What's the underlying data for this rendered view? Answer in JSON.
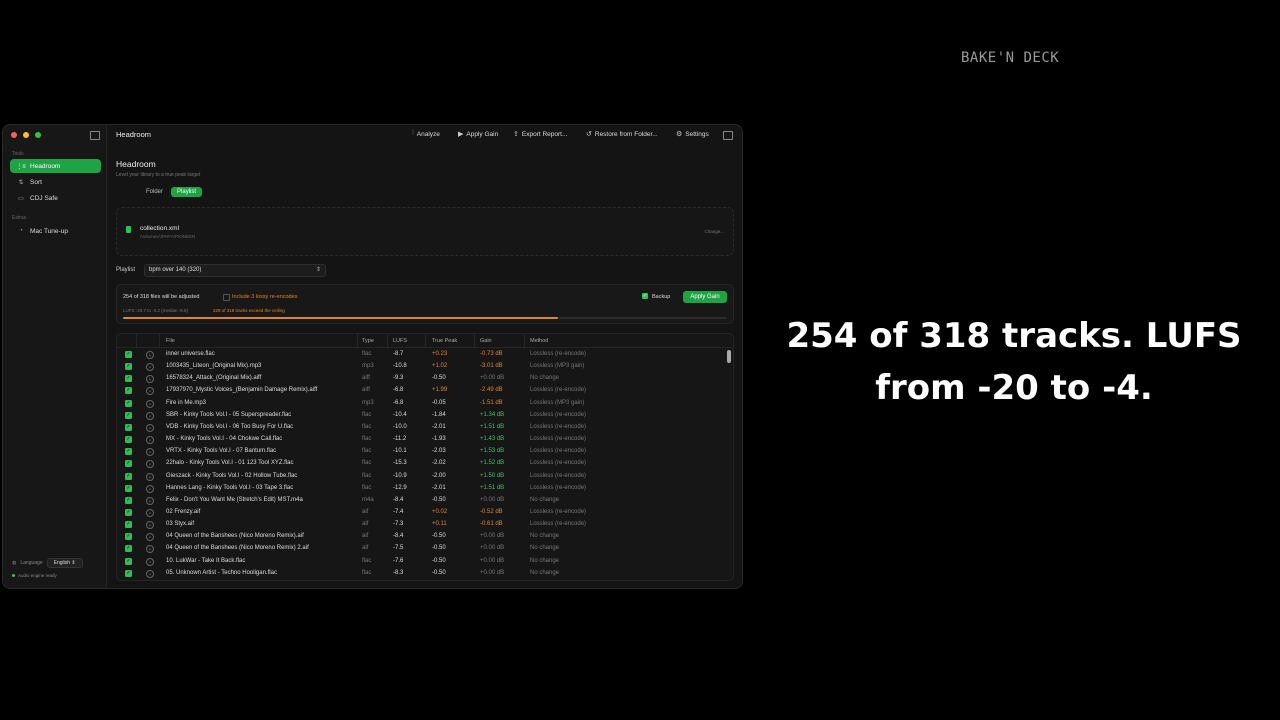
{
  "brand": "BAKE'N DECK",
  "caption_line1": "254 of 318 tracks. LUFS",
  "caption_line2": "from -20 to -4.",
  "sidebar": {
    "section_tools": "Tools",
    "items": [
      {
        "label": "Headroom",
        "icon": "waveform-icon"
      },
      {
        "label": "Sort",
        "icon": "sort-icon"
      },
      {
        "label": "CDJ Safe",
        "icon": "drive-icon"
      }
    ],
    "section_extras": "Extras",
    "extras": [
      {
        "label": "Mac Tune-up",
        "icon": "gauge-icon"
      }
    ],
    "language_label": "Language",
    "language_value": "English",
    "status": "Audio engine ready"
  },
  "toolbar": {
    "title": "Headroom",
    "analyze": "Analyze",
    "apply_gain": "Apply Gain",
    "export": "Export Report...",
    "restore": "Restore from Folder...",
    "settings": "Settings"
  },
  "page": {
    "title": "Headroom",
    "subtitle": "Level your library to a true peak target",
    "seg_folder": "Folder",
    "seg_playlist": "Playlist"
  },
  "file": {
    "name": "collection.xml",
    "path": "/Volumes/JPHFA/PIONEER",
    "change": "Change..."
  },
  "playlist": {
    "label": "Playlist",
    "value": "bpm over 140 (320)"
  },
  "summary": {
    "adjusted": "254 of 318 files will be adjusted",
    "lossy": "Include 3 lossy re-encodes",
    "backup": "Backup",
    "apply": "Apply Gain",
    "range": "LUFS -20.7 to -4.2 (median -8.8)",
    "exceed": "229 of 318 tracks exceed the ceiling",
    "progress": 0.72
  },
  "table": {
    "headers": {
      "file": "File",
      "type": "Type",
      "lufs": "LUFS",
      "tp": "True Peak",
      "gain": "Gain",
      "method": "Method"
    },
    "rows": [
      {
        "file": "inner universe.flac",
        "type": "flac",
        "lufs": "-8.7",
        "tp": "+0.23",
        "gain": "-0.73 dB",
        "method": "Lossless (re-encode)"
      },
      {
        "file": "1003435_Liteon_(Original Mix).mp3",
        "type": "mp3",
        "lufs": "-10.8",
        "tp": "+1.02",
        "gain": "-3.01 dB",
        "method": "Lossless (MP3 gain)"
      },
      {
        "file": "16578324_Attack_(Original Mix).aiff",
        "type": "aiff",
        "lufs": "-9.3",
        "tp": "-0.50",
        "gain": "+0.00 dB",
        "method": "No change"
      },
      {
        "file": "17937970_Mystic Voices_(Benjamin Damage Remix).aiff",
        "type": "aiff",
        "lufs": "-6.8",
        "tp": "+1.99",
        "gain": "-2.49 dB",
        "method": "Lossless (re-encode)"
      },
      {
        "file": "Fire in Me.mp3",
        "type": "mp3",
        "lufs": "-6.8",
        "tp": "-0.05",
        "gain": "-1.51 dB",
        "method": "Lossless (MP3 gain)"
      },
      {
        "file": "SBR - Kinky Tools Vol.I - 05 Superspreader.flac",
        "type": "flac",
        "lufs": "-10.4",
        "tp": "-1.84",
        "gain": "+1.34 dB",
        "method": "Lossless (re-encode)"
      },
      {
        "file": "VDB - Kinky Tools Vol.I - 06 Too Busy For U.flac",
        "type": "flac",
        "lufs": "-10.0",
        "tp": "-2.01",
        "gain": "+1.51 dB",
        "method": "Lossless (re-encode)"
      },
      {
        "file": "MX - Kinky Tools Vol.I - 04 Chokwe Call.flac",
        "type": "flac",
        "lufs": "-11.2",
        "tp": "-1.93",
        "gain": "+1.43 dB",
        "method": "Lossless (re-encode)"
      },
      {
        "file": "VRTX - Kinky Tools Vol.I - 07 Bantum.flac",
        "type": "flac",
        "lufs": "-10.1",
        "tp": "-2.03",
        "gain": "+1.53 dB",
        "method": "Lossless (re-encode)"
      },
      {
        "file": "22halo - Kinky Tools Vol.I - 01 123 Tool XYZ.flac",
        "type": "flac",
        "lufs": "-15.3",
        "tp": "-2.02",
        "gain": "+1.52 dB",
        "method": "Lossless (re-encode)"
      },
      {
        "file": "Gieszack - Kinky Tools Vol.I - 02 Hollow Tube.flac",
        "type": "flac",
        "lufs": "-10.9",
        "tp": "-2.00",
        "gain": "+1.50 dB",
        "method": "Lossless (re-encode)"
      },
      {
        "file": "Hannes Lang - Kinky Tools Vol.I - 03 Tape 3.flac",
        "type": "flac",
        "lufs": "-12.9",
        "tp": "-2.01",
        "gain": "+1.51 dB",
        "method": "Lossless (re-encode)"
      },
      {
        "file": "Felix - Don't You Want Me (Stretch's Edit) MST.m4a",
        "type": "m4a",
        "lufs": "-8.4",
        "tp": "-0.50",
        "gain": "+0.00 dB",
        "method": "No change"
      },
      {
        "file": "02 Frenzy.aif",
        "type": "aif",
        "lufs": "-7.4",
        "tp": "+0.02",
        "gain": "-0.52 dB",
        "method": "Lossless (re-encode)"
      },
      {
        "file": "03 Styx.aif",
        "type": "aif",
        "lufs": "-7.3",
        "tp": "+0.11",
        "gain": "-0.61 dB",
        "method": "Lossless (re-encode)"
      },
      {
        "file": "04 Queen of the Banshees (Nico Moreno Remix).aif",
        "type": "aif",
        "lufs": "-8.4",
        "tp": "-0.50",
        "gain": "+0.00 dB",
        "method": "No change"
      },
      {
        "file": "04 Queen of the Banshees (Nico Moreno Remix) 2.aif",
        "type": "aif",
        "lufs": "-7.5",
        "tp": "-0.50",
        "gain": "+0.00 dB",
        "method": "No change"
      },
      {
        "file": "10. LukWar - Take It Back.flac",
        "type": "flac",
        "lufs": "-7.6",
        "tp": "-0.50",
        "gain": "+0.00 dB",
        "method": "No change"
      },
      {
        "file": "05. Unknown Artist - Techno Hooligan.flac",
        "type": "flac",
        "lufs": "-8.3",
        "tp": "-0.50",
        "gain": "+0.00 dB",
        "method": "No change"
      }
    ]
  },
  "colors": {
    "accent": "#1fa347",
    "warn": "#e0862a",
    "pos": "#3cc469",
    "neutral": "#777777"
  }
}
